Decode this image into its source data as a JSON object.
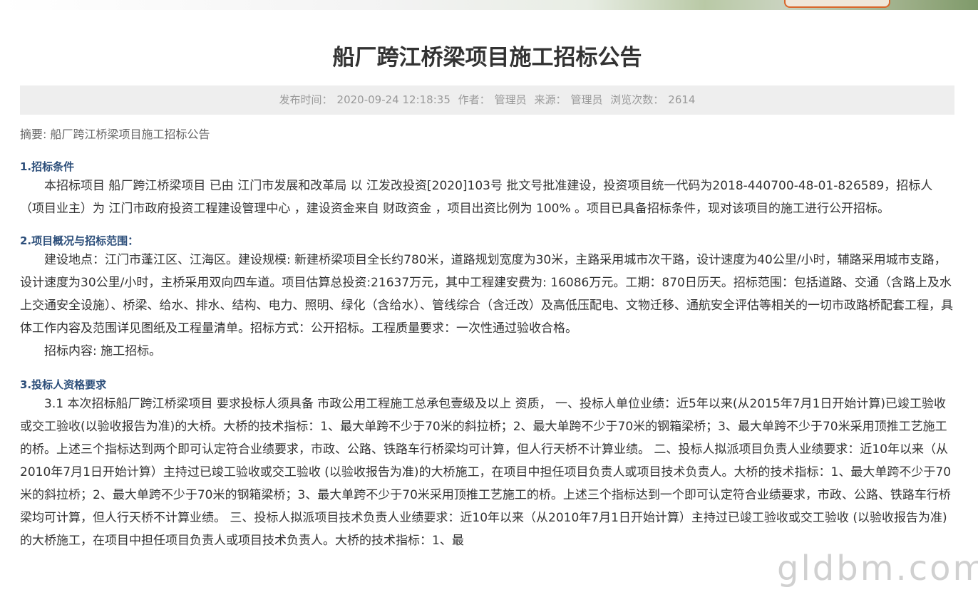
{
  "header": {
    "title": "船厂跨江桥梁项目施工招标公告"
  },
  "meta": {
    "publish_label": "发布时间：",
    "publish_time": "2020-09-24 12:18:35",
    "author_label": "作者：",
    "author": "管理员",
    "source_label": "来源：",
    "source": "管理员",
    "views_label": "浏览次数：",
    "views": "2614"
  },
  "summary": "摘要: 船厂跨江桥梁项目施工招标公告",
  "sections": [
    {
      "title": "1.招标条件",
      "paragraphs": [
        "本招标项目 船厂跨江桥梁项目 已由 江门市发展和改革局 以 江发改投资[2020]103号 批文号批准建设，投资项目统一代码为2018-440700-48-01-826589，招标人（项目业主）为 江门市政府投资工程建设管理中心 ，建设资金来自 财政资金 ，项目出资比例为 100% 。项目已具备招标条件，现对该项目的施工进行公开招标。"
      ]
    },
    {
      "title": "2.项目概况与招标范围：",
      "paragraphs": [
        "建设地点：江门市蓬江区、江海区。建设规模: 新建桥梁项目全长约780米，道路规划宽度为30米，主路采用城市次干路，设计速度为40公里/小时，辅路采用城市支路，设计速度为30公里/小时，主桥采用双向四车道。项目估算总投资:21637万元，其中工程建安费为: 16086万元。工期：870日历天。招标范围：包括道路、交通（含路上及水上交通安全设施）、桥梁、给水、排水、结构、电力、照明、绿化（含给水）、管线综合（含迁改）及高低压配电、文物迁移、通航安全评估等相关的一切市政路桥配套工程，具体工作内容及范围详见图纸及工程量清单。招标方式：公开招标。工程质量要求：一次性通过验收合格。",
        "招标内容: 施工招标。"
      ]
    },
    {
      "title": "3.投标人资格要求",
      "paragraphs": [
        "3.1 本次招标船厂跨江桥梁项目 要求投标人须具备 市政公用工程施工总承包壹级及以上 资质， 一、投标人单位业绩：近5年以来(从2015年7月1日开始计算)已竣工验收或交工验收(以验收报告为准)的大桥。大桥的技术指标：1、最大单跨不少于70米的斜拉桥；2、最大单跨不少于70米的钢箱梁桥；3、最大单跨不少于70米采用顶推工艺施工的桥。上述三个指标达到两个即可认定符合业绩要求，市政、公路、铁路车行桥梁均可计算，但人行天桥不计算业绩。 二、投标人拟派项目负责人业绩要求：近10年以来（从2010年7月1日开始计算）主持过已竣工验收或交工验收 (以验收报告为准)的大桥施工，在项目中担任项目负责人或项目技术负责人。大桥的技术指标：1、最大单跨不少于70米的斜拉桥；2、最大单跨不少于70米的钢箱梁桥；3、最大单跨不少于70米采用顶推工艺施工的桥。上述三个指标达到一个即可认定符合业绩要求，市政、公路、铁路车行桥梁均可计算，但人行天桥不计算业绩。 三、投标人拟派项目技术负责人业绩要求：近10年以来（从2010年7月1日开始计算）主持过已竣工验收或交工验收 (以验收报告为准)的大桥施工，在项目中担任项目负责人或项目技术负责人。大桥的技术指标：1、最"
      ]
    }
  ],
  "watermark": "gldbm.com",
  "colors": {
    "section_title": "#2c4e7a",
    "meta_bg": "#eeeeee",
    "meta_text": "#999999"
  }
}
